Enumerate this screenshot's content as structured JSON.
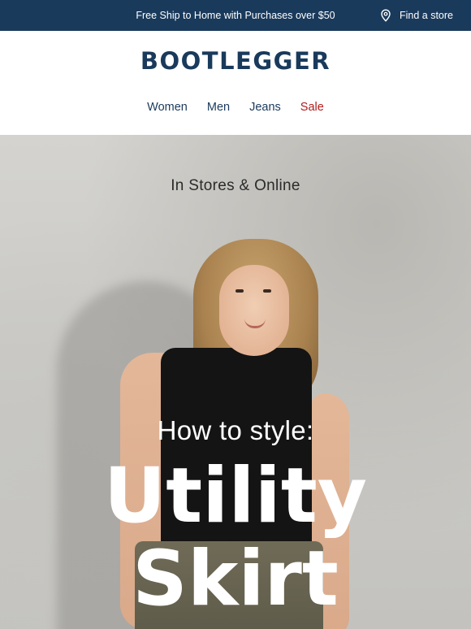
{
  "topbar": {
    "promo": "Free Ship to Home with Purchases over $50",
    "store_link": "Find a store",
    "store_icon": "location-pin-icon"
  },
  "header": {
    "logo": "BOOTLEGGER",
    "nav": [
      {
        "label": "Women"
      },
      {
        "label": "Men"
      },
      {
        "label": "Jeans"
      },
      {
        "label": "Sale",
        "color": "#b01c1c"
      }
    ]
  },
  "hero": {
    "eyebrow": "In Stores & Online",
    "kicker": "How to style:",
    "headline_line1": "Utility",
    "headline_line2": "Skirt"
  },
  "colors": {
    "brand": "#1a3a5c",
    "sale": "#b01c1c"
  }
}
